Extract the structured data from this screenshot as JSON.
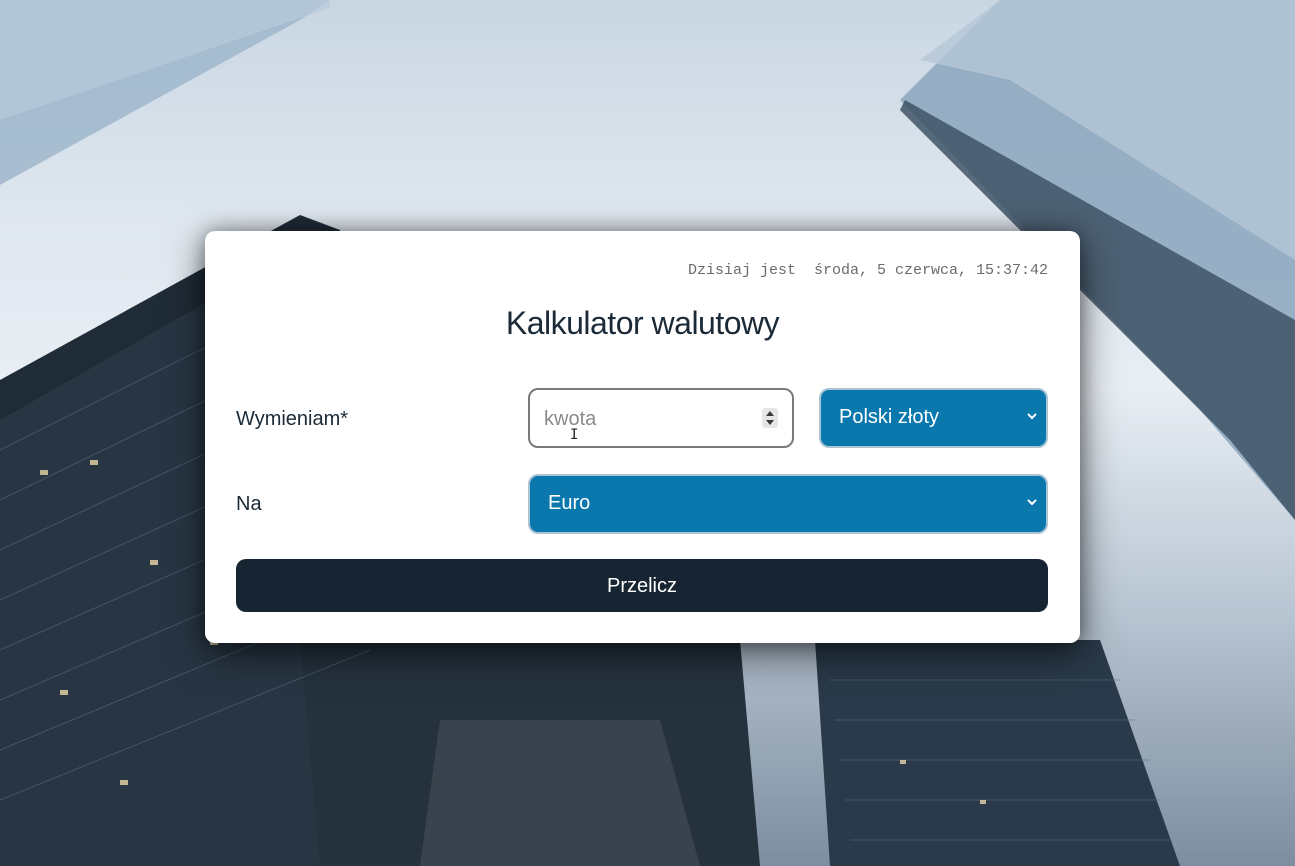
{
  "header": {
    "datetime": "Dzisiaj jest  środa, 5 czerwca, 15:37:42"
  },
  "form": {
    "title": "Kalkulator walutowy",
    "from_label": "Wymieniam*",
    "to_label": "Na",
    "amount": {
      "value": "",
      "placeholder": "kwota"
    },
    "from_currency": "Polski złoty",
    "to_currency": "Euro",
    "convert_label": "Przelicz"
  },
  "colors": {
    "select_bg": "#0a78ad",
    "button_bg": "#172533",
    "text_dark": "#1b2a36"
  },
  "icons": {
    "spinner": "number-spinner-icon",
    "chevron": "chevron-down-icon",
    "cursor": "text-cursor-icon"
  }
}
